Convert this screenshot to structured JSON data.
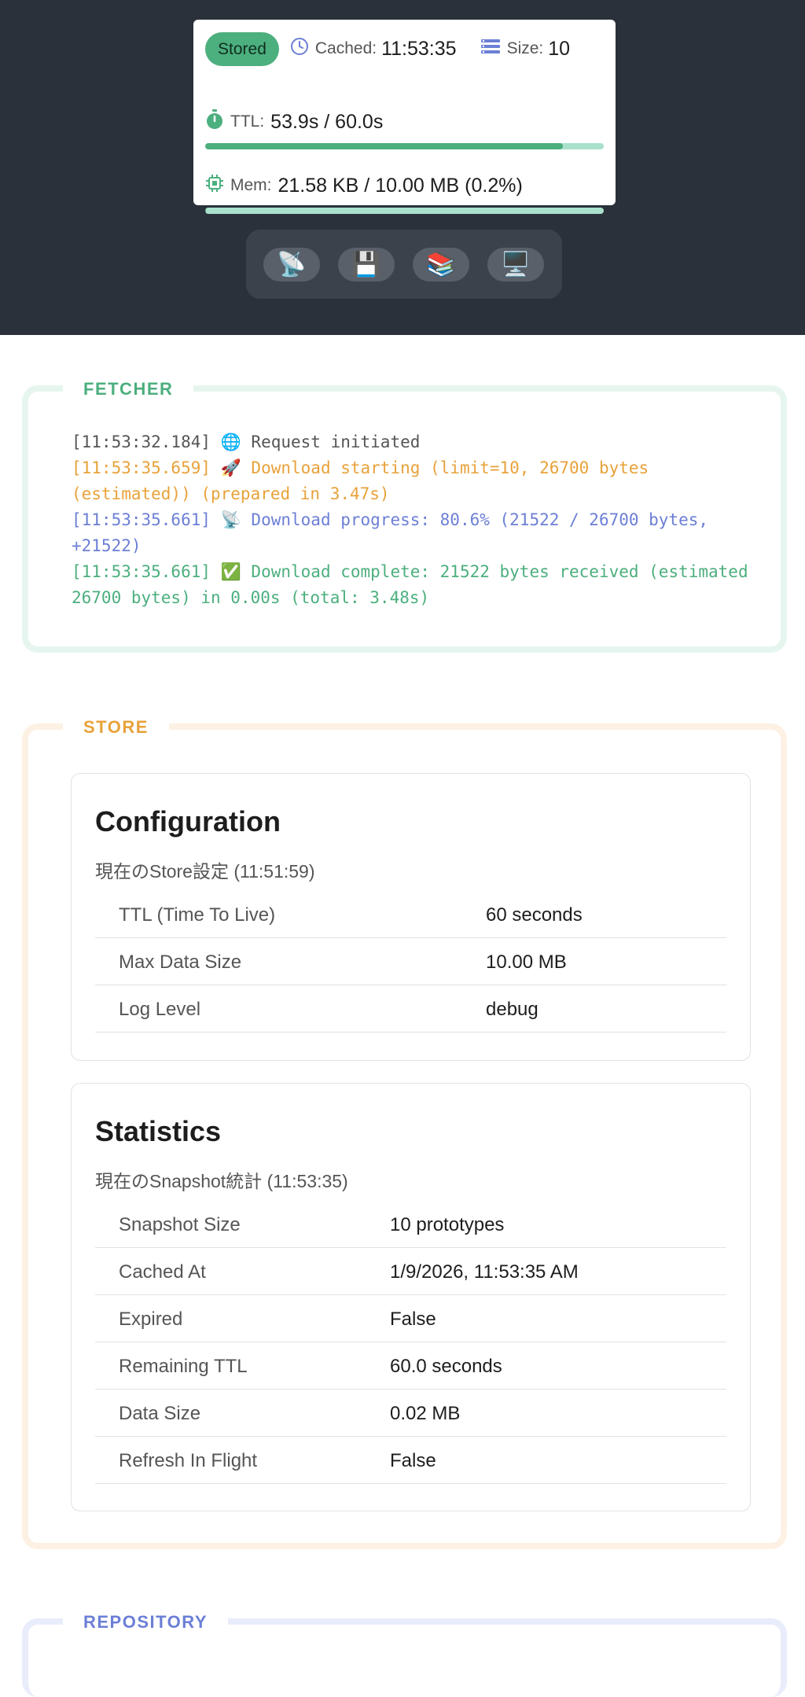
{
  "header": {
    "badge": "Stored",
    "cached_label": "Cached:",
    "cached_value": "11:53:35",
    "size_label": "Size:",
    "size_value": "10",
    "ttl_label": "TTL:",
    "ttl_value": "53.9s / 60.0s",
    "ttl_fraction": 0.898,
    "mem_label": "Mem:",
    "mem_value": "21.58 KB / 10.00 MB (0.2%)",
    "mem_fraction": 0.002,
    "colors": {
      "accent_green": "#4caf7e",
      "clock_blue": "#6c7fd6",
      "bar_track": "#a9e1cc"
    }
  },
  "toolbar": {
    "items": [
      {
        "icon": "satellite-dish-icon",
        "glyph": "📡"
      },
      {
        "icon": "floppy-disk-icon",
        "glyph": "💾"
      },
      {
        "icon": "books-icon",
        "glyph": "📚"
      },
      {
        "icon": "desktop-computer-icon",
        "glyph": "🖥️"
      }
    ]
  },
  "fetcher": {
    "title": "FETCHER",
    "logs": [
      {
        "text": "[11:53:32.184] 🌐 Request initiated",
        "color": "gray"
      },
      {
        "text": "[11:53:35.659] 🚀 Download starting (limit=10, 26700 bytes (estimated)) (prepared in 3.47s)",
        "color": "orange"
      },
      {
        "text": "[11:53:35.661] 📡 Download progress: 80.6% (21522 / 26700 bytes, +21522)",
        "color": "blue"
      },
      {
        "text": "[11:53:35.661] ✅ Download complete: 21522 bytes received (estimated 26700 bytes) in 0.00s (total: 3.48s)",
        "color": "green"
      }
    ]
  },
  "store": {
    "title": "STORE",
    "configuration": {
      "title": "Configuration",
      "subtitle": "現在のStore設定 (11:51:59)",
      "rows": [
        {
          "key": "TTL (Time To Live)",
          "value": "60 seconds"
        },
        {
          "key": "Max Data Size",
          "value": "10.00 MB"
        },
        {
          "key": "Log Level",
          "value": "debug"
        }
      ]
    },
    "statistics": {
      "title": "Statistics",
      "subtitle": "現在のSnapshot統計 (11:53:35)",
      "rows": [
        {
          "key": "Snapshot Size",
          "value": "10 prototypes"
        },
        {
          "key": "Cached At",
          "value": "1/9/2026, 11:53:35 AM"
        },
        {
          "key": "Expired",
          "value": "False"
        },
        {
          "key": "Remaining TTL",
          "value": "60.0 seconds"
        },
        {
          "key": "Data Size",
          "value": "0.02 MB"
        },
        {
          "key": "Refresh In Flight",
          "value": "False"
        }
      ]
    }
  },
  "repository": {
    "title": "REPOSITORY"
  }
}
